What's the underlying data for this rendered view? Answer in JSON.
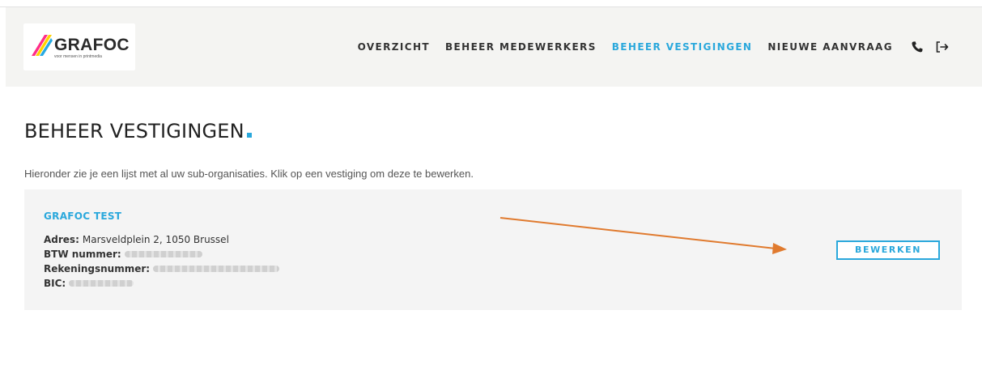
{
  "header": {
    "logo_text": "GRAFOC",
    "logo_subtext": "voor mensen in printmedia",
    "nav": [
      {
        "label": "OVERZICHT",
        "active": false
      },
      {
        "label": "BEHEER MEDEWERKERS",
        "active": false
      },
      {
        "label": "BEHEER VESTIGINGEN",
        "active": true
      },
      {
        "label": "NIEUWE AANVRAAG",
        "active": false
      }
    ],
    "icons": [
      "phone-icon",
      "logout-icon"
    ]
  },
  "page": {
    "title": "BEHEER VESTIGINGEN",
    "intro": "Hieronder zie je een lijst met al uw sub-organisaties. Klik op een vestiging om deze te bewerken."
  },
  "vestiging": {
    "name": "GRAFOC TEST",
    "address_label": "Adres:",
    "address_value": "Marsveldplein 2, 1050 Brussel",
    "btw_label": "BTW nummer:",
    "rekening_label": "Rekeningsnummer:",
    "bic_label": "BIC:",
    "edit_label": "BEWERKEN"
  },
  "colors": {
    "accent": "#2aa8dc",
    "arrow": "#e07a2e",
    "header_bg": "#f4f4f2",
    "card_bg": "#f4f4f4"
  }
}
